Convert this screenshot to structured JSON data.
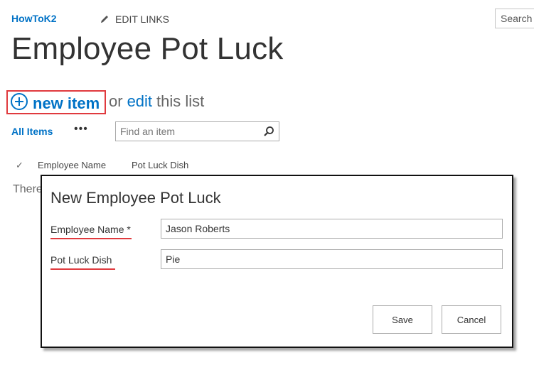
{
  "header": {
    "site_link": "HowToK2",
    "edit_links": "EDIT LINKS",
    "search_placeholder": "Search"
  },
  "page": {
    "title": "Employee Pot Luck"
  },
  "toolbar": {
    "new_item": "new item",
    "or": "or",
    "edit": "edit",
    "this_list": "this list",
    "view_name": "All Items",
    "more": "•••",
    "find_placeholder": "Find an item"
  },
  "list": {
    "columns": [
      "Employee Name",
      "Pot Luck Dish"
    ],
    "empty_message_visible": "There"
  },
  "dialog": {
    "title": "New Employee Pot Luck",
    "fields": [
      {
        "label": "Employee Name *",
        "value": "Jason Roberts"
      },
      {
        "label": "Pot Luck Dish",
        "value": "Pie"
      }
    ],
    "save_label": "Save",
    "cancel_label": "Cancel"
  },
  "colors": {
    "accent": "#0072c6",
    "highlight": "#e03a3e"
  }
}
